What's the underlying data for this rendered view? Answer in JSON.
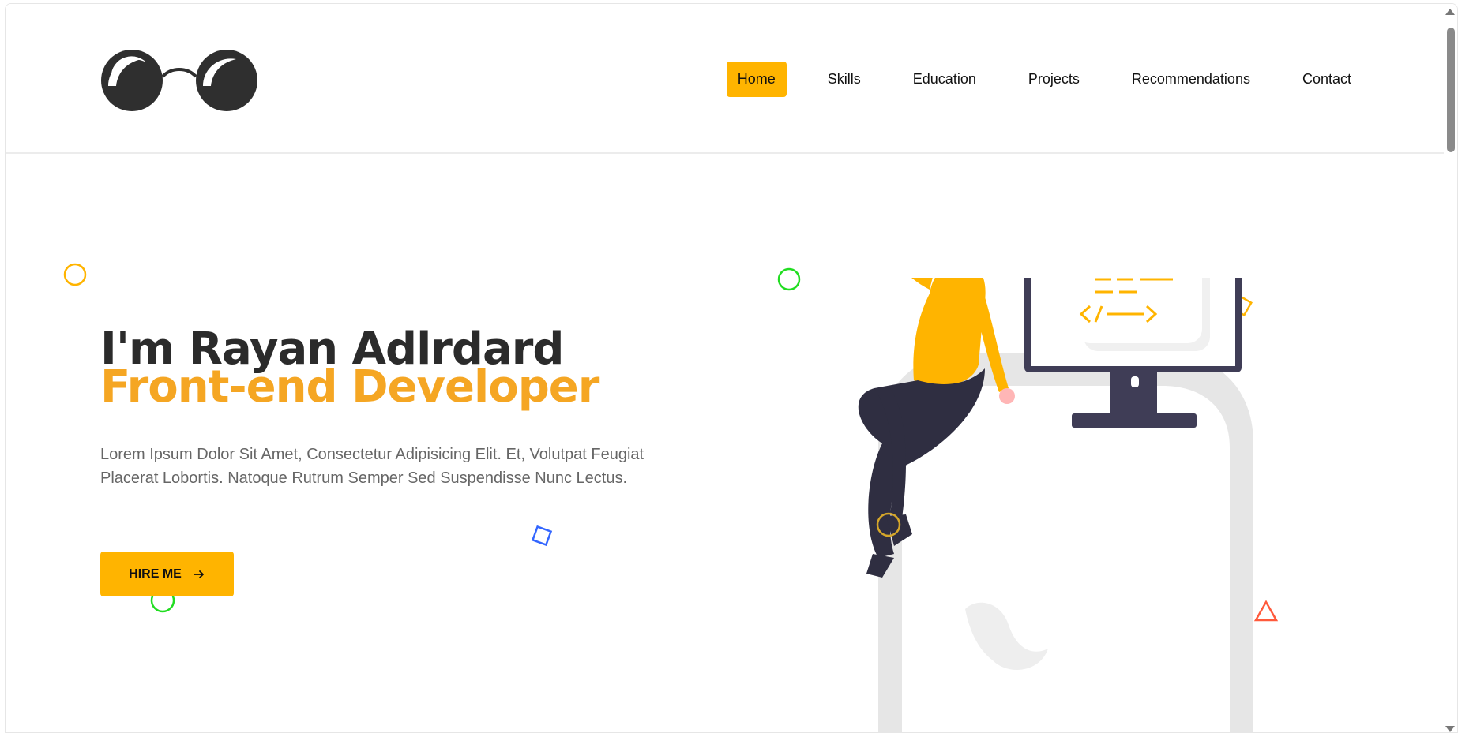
{
  "header": {
    "logo_icon": "round-glasses-icon",
    "nav": [
      {
        "label": "Home",
        "active": true
      },
      {
        "label": "Skills",
        "active": false
      },
      {
        "label": "Education",
        "active": false
      },
      {
        "label": "Projects",
        "active": false
      },
      {
        "label": "Recommendations",
        "active": false
      },
      {
        "label": "Contact",
        "active": false
      }
    ]
  },
  "hero": {
    "title": "I'm Rayan Adlrdard",
    "subtitle": "Front-end Developer",
    "description": "Lorem Ipsum Dolor Sit Amet, Consectetur Adipisicing Elit. Et, Volutpat Feugiat Placerat Lobortis. Natoque Rutrum Semper Sed Suspendisse Nunc Lectus.",
    "cta_label": "HIRE ME",
    "cta_icon": "arrow-right-icon"
  },
  "colors": {
    "accent": "#ffb400",
    "subtitle": "#f5a623",
    "dark": "#2b2b2b",
    "text_muted": "#666666"
  }
}
